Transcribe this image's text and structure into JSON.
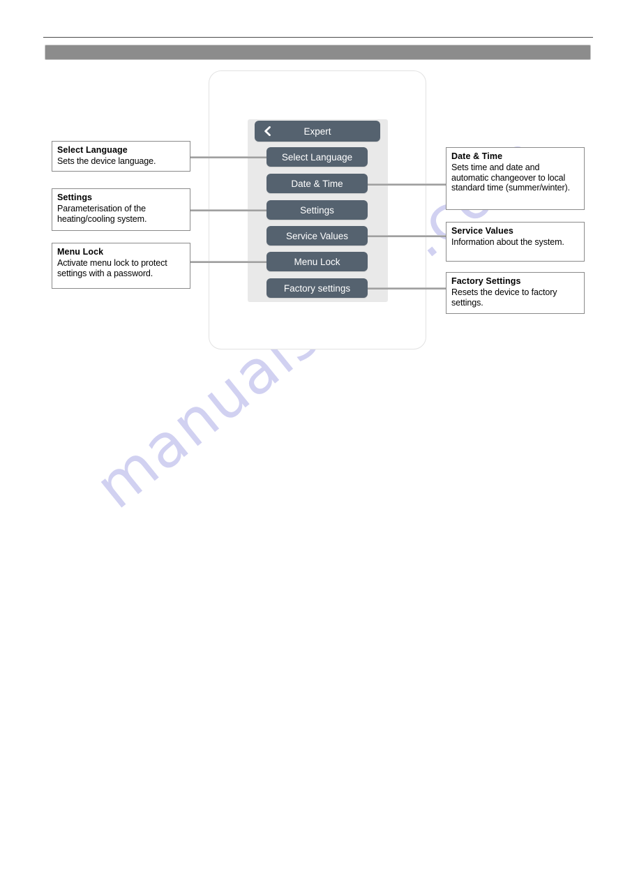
{
  "page": {
    "header_bar_color": "#8c8c8c",
    "watermark_text": "manualshive.com"
  },
  "device": {
    "screen_bg": "#e9e9e9",
    "button_color": "#55626f",
    "header": {
      "title": "Expert",
      "back_icon": "chevron-left-icon"
    },
    "menu_items": [
      {
        "label": "Select Language"
      },
      {
        "label": "Date & Time"
      },
      {
        "label": "Settings"
      },
      {
        "label": "Service Values"
      },
      {
        "label": "Menu Lock"
      },
      {
        "label": "Factory settings"
      }
    ]
  },
  "callouts": {
    "left": [
      {
        "title": "Select Language",
        "description": "Sets the device language."
      },
      {
        "title": "Settings",
        "description": "Parameterisation of the heating/cooling system."
      },
      {
        "title": "Menu Lock",
        "description": "Activate menu lock to protect settings with a password."
      }
    ],
    "right": [
      {
        "title": "Date & Time",
        "description": "Sets time and date and automatic changeover to local standard time (summer/winter)."
      },
      {
        "title": "Service Values",
        "description": "Information about the system."
      },
      {
        "title": "Factory Settings",
        "description": "Resets the device to factory settings."
      }
    ]
  }
}
